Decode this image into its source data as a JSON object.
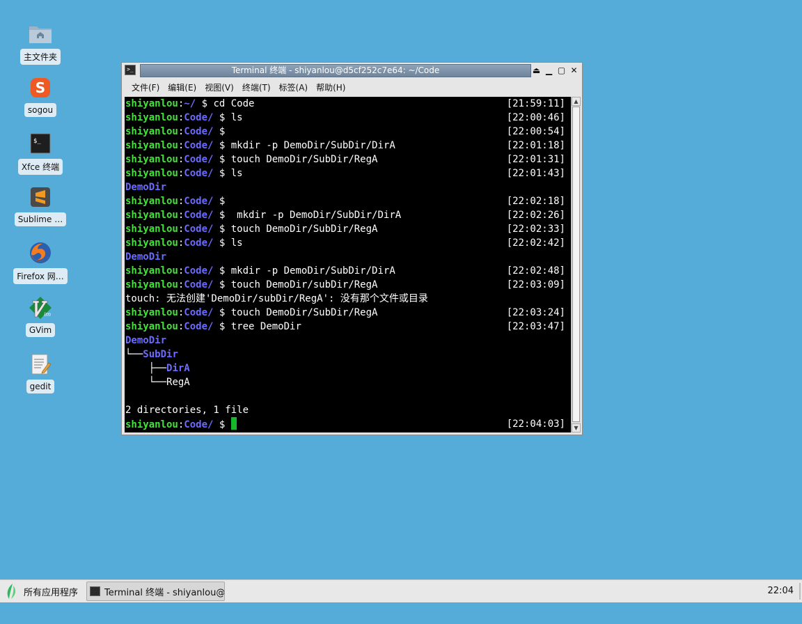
{
  "desktop": {
    "icons": [
      {
        "label": "主文件夹",
        "icon": "home-folder-icon"
      },
      {
        "label": "sogou",
        "icon": "sogou-icon"
      },
      {
        "label": "Xfce 终端",
        "icon": "terminal-icon"
      },
      {
        "label": "Sublime …",
        "icon": "sublime-icon"
      },
      {
        "label": "Firefox 网…",
        "icon": "firefox-icon"
      },
      {
        "label": "GVim",
        "icon": "gvim-icon"
      },
      {
        "label": "gedit",
        "icon": "gedit-icon"
      }
    ]
  },
  "window": {
    "title": "Terminal 终端 - shiyanlou@d5cf252c7e64: ~/Code",
    "menu": [
      "文件(F)",
      "编辑(E)",
      "视图(V)",
      "终端(T)",
      "标签(A)",
      "帮助(H)"
    ]
  },
  "terminal": {
    "user": "shiyanlou",
    "lines": [
      {
        "type": "prompt",
        "path": "~/",
        "cmd": "cd Code",
        "ts": "[21:59:11]"
      },
      {
        "type": "prompt",
        "path": "Code/",
        "cmd": "ls",
        "ts": "[22:00:46]"
      },
      {
        "type": "prompt",
        "path": "Code/",
        "cmd": "",
        "ts": "[22:00:54]"
      },
      {
        "type": "prompt",
        "path": "Code/",
        "cmd": "mkdir -p DemoDir/SubDir/DirA",
        "ts": "[22:01:18]"
      },
      {
        "type": "prompt",
        "path": "Code/",
        "cmd": "touch DemoDir/SubDir/RegA",
        "ts": "[22:01:31]"
      },
      {
        "type": "prompt",
        "path": "Code/",
        "cmd": "ls",
        "ts": "[22:01:43]"
      },
      {
        "type": "dir",
        "text": "DemoDir"
      },
      {
        "type": "prompt",
        "path": "Code/",
        "cmd": "",
        "ts": "[22:02:18]"
      },
      {
        "type": "prompt",
        "path": "Code/",
        "cmd": " mkdir -p DemoDir/SubDir/DirA",
        "ts": "[22:02:26]"
      },
      {
        "type": "prompt",
        "path": "Code/",
        "cmd": "touch DemoDir/SubDir/RegA",
        "ts": "[22:02:33]"
      },
      {
        "type": "prompt",
        "path": "Code/",
        "cmd": "ls",
        "ts": "[22:02:42]"
      },
      {
        "type": "dir",
        "text": "DemoDir"
      },
      {
        "type": "prompt",
        "path": "Code/",
        "cmd": "mkdir -p DemoDir/SubDir/DirA",
        "ts": "[22:02:48]"
      },
      {
        "type": "prompt",
        "path": "Code/",
        "cmd": "touch DemoDir/subDir/RegA",
        "ts": "[22:03:09]"
      },
      {
        "type": "text",
        "text": "touch: 无法创建'DemoDir/subDir/RegA': 没有那个文件或目录"
      },
      {
        "type": "prompt",
        "path": "Code/",
        "cmd": "touch DemoDir/SubDir/RegA",
        "ts": "[22:03:24]"
      },
      {
        "type": "prompt",
        "path": "Code/",
        "cmd": "tree DemoDir",
        "ts": "[22:03:47]"
      },
      {
        "type": "dir",
        "text": "DemoDir"
      },
      {
        "type": "tree",
        "prefix": "└──",
        "name": "SubDir",
        "isdir": true
      },
      {
        "type": "tree",
        "prefix": "    ├──",
        "name": "DirA",
        "isdir": true
      },
      {
        "type": "tree",
        "prefix": "    └──",
        "name": "RegA",
        "isdir": false
      },
      {
        "type": "text",
        "text": ""
      },
      {
        "type": "text",
        "text": "2 directories, 1 file"
      },
      {
        "type": "prompt",
        "path": "Code/",
        "cmd": "",
        "ts": "[22:04:03]",
        "cursor": true
      }
    ]
  },
  "taskbar": {
    "apps_label": "所有应用程序",
    "task_label": "Terminal 终端 - shiyanlou@…",
    "clock": "22:04"
  }
}
